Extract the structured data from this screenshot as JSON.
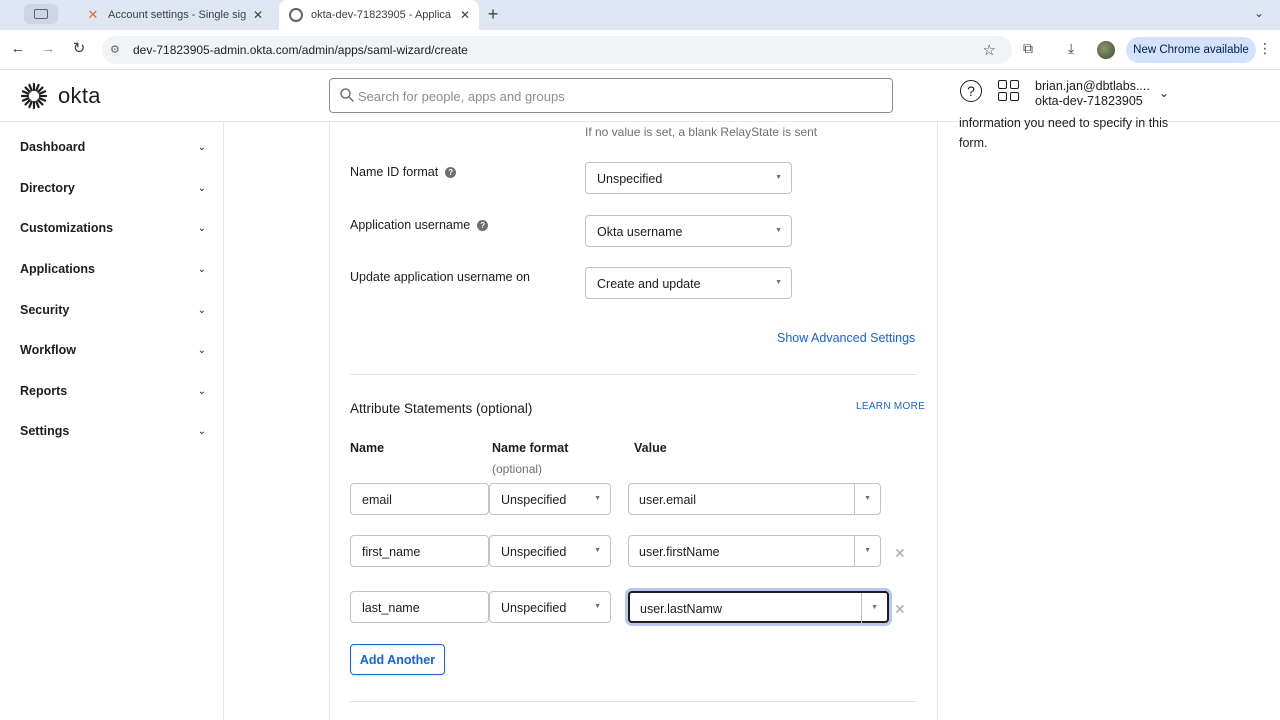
{
  "browser": {
    "tabs": [
      {
        "title": "Account settings - Single sig",
        "active": false,
        "icon": "dbt-x-icon"
      },
      {
        "title": "okta-dev-71823905 - Applica",
        "active": true,
        "icon": "okta-circle-icon"
      }
    ],
    "url": "dev-71823905-admin.okta.com/admin/apps/saml-wizard/create",
    "new_chrome_label": "New Chrome available"
  },
  "header": {
    "logo_text": "okta",
    "search_placeholder": "Search for people, apps and groups",
    "user_email": "brian.jan@dbtlabs....",
    "user_org": "okta-dev-71823905"
  },
  "sidebar": {
    "items": [
      {
        "label": "Dashboard"
      },
      {
        "label": "Directory"
      },
      {
        "label": "Customizations"
      },
      {
        "label": "Applications"
      },
      {
        "label": "Security"
      },
      {
        "label": "Workflow"
      },
      {
        "label": "Reports"
      },
      {
        "label": "Settings"
      }
    ]
  },
  "form": {
    "relay_help": "If no value is set, a blank RelayState is sent",
    "name_id_format": {
      "label": "Name ID format",
      "value": "Unspecified"
    },
    "app_username": {
      "label": "Application username",
      "value": "Okta username"
    },
    "update_username_on": {
      "label": "Update application username on",
      "value": "Create and update"
    },
    "show_advanced": "Show Advanced Settings"
  },
  "attributes": {
    "title": "Attribute Statements (optional)",
    "learn_more": "LEARN MORE",
    "headers": {
      "name": "Name",
      "format": "Name format",
      "format_sub": "(optional)",
      "value": "Value"
    },
    "rows": [
      {
        "name": "email",
        "format": "Unspecified",
        "value": "user.email",
        "removable": false,
        "focused": false
      },
      {
        "name": "first_name",
        "format": "Unspecified",
        "value": "user.firstName",
        "removable": true,
        "focused": false
      },
      {
        "name": "last_name",
        "format": "Unspecified",
        "value": "user.lastNamw",
        "removable": true,
        "focused": true
      }
    ],
    "add_another": "Add Another"
  },
  "right_panel": {
    "line1": "information you need to specify in this",
    "line2": "form."
  }
}
